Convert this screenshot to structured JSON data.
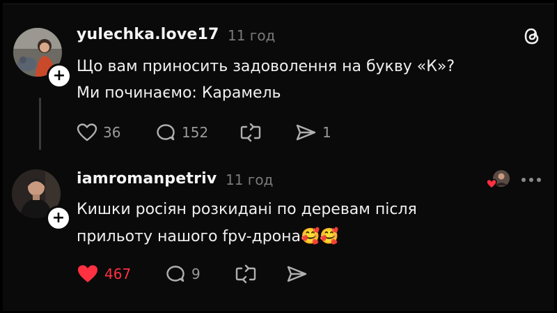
{
  "posts": [
    {
      "username": "yulechka.love17",
      "time": "11 год",
      "lines": [
        "Що вам приносить задоволення на букву «К»?",
        "Ми починаємо: Карамель"
      ],
      "likes": "36",
      "replies": "152",
      "shares": "1",
      "liked": false
    },
    {
      "username": "iamromanpetriv",
      "time": "11 год",
      "lines": [
        "Кишки росіян розкидані по деревам після",
        "прильоту нашого fpv-дрона🥰🥰"
      ],
      "likes": "467",
      "replies": "9",
      "liked": true
    }
  ],
  "icons": {
    "follow": "+",
    "logo": "threads-logo-icon",
    "more": "more-dots-icon"
  },
  "colors": {
    "liked": "#ff3040",
    "muted": "#9a9a9a",
    "background": "#0a0a0a"
  }
}
